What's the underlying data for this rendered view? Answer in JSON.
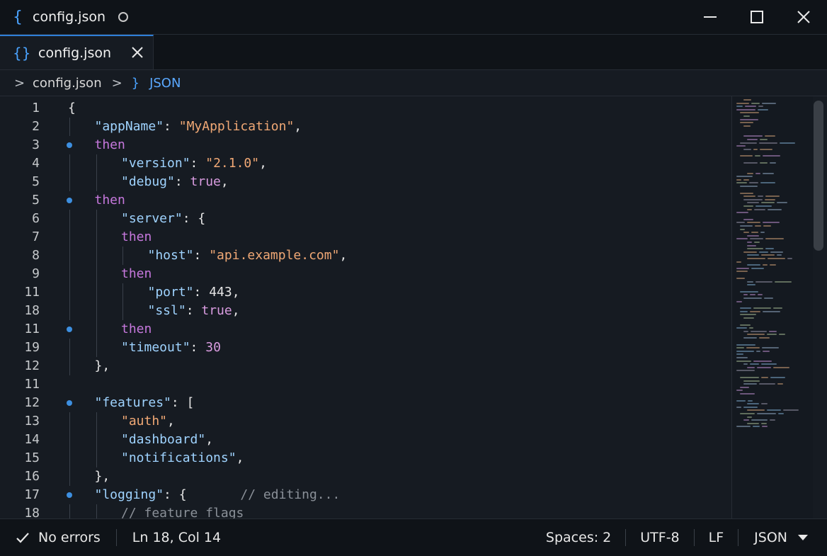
{
  "window": {
    "title": "config.json",
    "title_icon": "json-braces-icon",
    "controls": [
      "minimize-icon",
      "maximize-icon",
      "close-icon"
    ]
  },
  "tabs": [
    {
      "label": "config.json",
      "icon": "json-braces-icon",
      "active": true
    }
  ],
  "breadcrumb": {
    "file": "config.json",
    "symbol": "JSON"
  },
  "editor": {
    "lines": [
      {
        "num": "1",
        "indent": 0,
        "bullet": false,
        "tokens": [
          [
            "p",
            "{"
          ]
        ]
      },
      {
        "num": "2",
        "indent": 1,
        "bullet": false,
        "tokens": [
          [
            "k",
            "\"appName\""
          ],
          [
            "p",
            ": "
          ],
          [
            "s",
            "\"MyApplication\""
          ],
          [
            "p",
            ","
          ]
        ]
      },
      {
        "num": "3",
        "indent": 1,
        "bullet": true,
        "tokens": [
          [
            "kw",
            "then"
          ]
        ]
      },
      {
        "num": "4",
        "indent": 2,
        "bullet": false,
        "tokens": [
          [
            "k",
            "\"version\""
          ],
          [
            "p",
            ": "
          ],
          [
            "s",
            "\"2.1.0\""
          ],
          [
            "p",
            ","
          ]
        ]
      },
      {
        "num": "5",
        "indent": 2,
        "bullet": false,
        "tokens": [
          [
            "k",
            "\"debug\""
          ],
          [
            "p",
            ": "
          ],
          [
            "nb",
            "true"
          ],
          [
            "p",
            ","
          ]
        ]
      },
      {
        "num": "5",
        "indent": 1,
        "bullet": true,
        "tokens": [
          [
            "kw",
            "then"
          ]
        ]
      },
      {
        "num": "6",
        "indent": 2,
        "bullet": false,
        "tokens": [
          [
            "k",
            "\"server\""
          ],
          [
            "p",
            ": {"
          ]
        ]
      },
      {
        "num": "7",
        "indent": 2,
        "bullet": false,
        "tokens": [
          [
            "kw",
            "then"
          ]
        ]
      },
      {
        "num": "8",
        "indent": 3,
        "bullet": false,
        "tokens": [
          [
            "k",
            "\"host\""
          ],
          [
            "p",
            ": "
          ],
          [
            "s",
            "\"api.example.com\""
          ],
          [
            "p",
            ","
          ]
        ]
      },
      {
        "num": "9",
        "indent": 2,
        "bullet": false,
        "tokens": [
          [
            "kw",
            "then"
          ]
        ]
      },
      {
        "num": "11",
        "indent": 3,
        "bullet": false,
        "tokens": [
          [
            "k",
            "\"port\""
          ],
          [
            "p",
            ": "
          ],
          [
            "n",
            "443"
          ],
          [
            "p",
            ","
          ]
        ]
      },
      {
        "num": "18",
        "indent": 3,
        "bullet": false,
        "tokens": [
          [
            "k",
            "\"ssl\""
          ],
          [
            "p",
            ": "
          ],
          [
            "nb",
            "true"
          ],
          [
            "p",
            ","
          ]
        ]
      },
      {
        "num": "11",
        "indent": 2,
        "bullet": true,
        "tokens": [
          [
            "kw",
            "then"
          ]
        ]
      },
      {
        "num": "19",
        "indent": 2,
        "bullet": false,
        "tokens": [
          [
            "k",
            "\"timeout\""
          ],
          [
            "p",
            ": "
          ],
          [
            "nb",
            "30"
          ]
        ]
      },
      {
        "num": "12",
        "indent": 1,
        "bullet": false,
        "tokens": [
          [
            "p",
            "},"
          ]
        ]
      },
      {
        "num": "11",
        "indent": 0,
        "bullet": false,
        "tokens": []
      },
      {
        "num": "12",
        "indent": 1,
        "bullet": true,
        "tokens": [
          [
            "k",
            "\"features\""
          ],
          [
            "p",
            ": ["
          ]
        ]
      },
      {
        "num": "13",
        "indent": 2,
        "bullet": false,
        "tokens": [
          [
            "s",
            "\"auth\""
          ],
          [
            "p",
            ","
          ]
        ]
      },
      {
        "num": "14",
        "indent": 2,
        "bullet": false,
        "tokens": [
          [
            "k",
            "\"dashboard\""
          ],
          [
            "p",
            ","
          ]
        ]
      },
      {
        "num": "15",
        "indent": 2,
        "bullet": false,
        "tokens": [
          [
            "k",
            "\"notifications\""
          ],
          [
            "p",
            ","
          ]
        ]
      },
      {
        "num": "16",
        "indent": 1,
        "bullet": false,
        "tokens": [
          [
            "p",
            "},"
          ]
        ]
      },
      {
        "num": "17",
        "indent": 1,
        "bullet": true,
        "tokens": [
          [
            "k",
            "\"logging\""
          ],
          [
            "p",
            ": {"
          ],
          [
            "c",
            "       // editing..."
          ]
        ]
      },
      {
        "num": "18",
        "indent": 2,
        "bullet": false,
        "tokens": [
          [
            "c",
            "// feature flags"
          ]
        ]
      }
    ]
  },
  "status": {
    "errors": "No errors",
    "errors_icon": "check-icon",
    "position": "Ln 18, Col 14",
    "spaces": "Spaces: 2",
    "encoding": "UTF-8",
    "eol": "LF",
    "language": "JSON",
    "language_dropdown_icon": "caret-down-icon"
  },
  "colors": {
    "accent": "#2f7fd8",
    "key": "#9fd3ff",
    "string": "#f0a875",
    "keyword": "#c678dd",
    "comment": "#8a9098"
  }
}
